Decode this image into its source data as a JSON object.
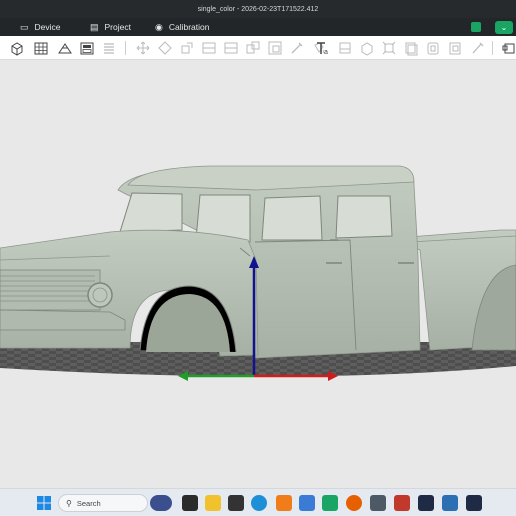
{
  "window": {
    "title": "single_color - 2026-02-23T171522.412"
  },
  "menubar": {
    "tabs": [
      {
        "label": "Device",
        "icon": "monitor-icon"
      },
      {
        "label": "Project",
        "icon": "project-icon"
      },
      {
        "label": "Calibration",
        "icon": "calibration-icon"
      }
    ],
    "right_button_icon": "chevron-down-icon"
  },
  "toolbar": {
    "icons": [
      "add-cube-icon",
      "grid-icon",
      "auto-orient-icon",
      "arrange-icon",
      "list-icon",
      "move-icon",
      "rotate-icon",
      "scale-icon",
      "cut-icon",
      "boolean-icon",
      "support-icon",
      "paint-icon",
      "seam-icon",
      "text-icon",
      "slice-plane-icon",
      "measure-icon",
      "assembly-icon",
      "split-icon",
      "variable-layer-icon",
      "emboss-icon"
    ]
  },
  "viewport": {
    "scene": "pickup-truck-model",
    "colors": {
      "model": "#b8c2b6",
      "bed": "#5b5b5b",
      "x_axis": "#d01c1c",
      "y_axis": "#1f9e2a",
      "z_axis": "#12128f"
    }
  },
  "taskbar": {
    "search_placeholder": "Search",
    "apps": [
      "windows-start-icon",
      "search-icon",
      "widgets-icon",
      "task-view-icon",
      "file-explorer-icon",
      "app-icon",
      "edge-icon",
      "app-icon",
      "store-icon",
      "app-icon",
      "firefox-icon",
      "calculator-icon",
      "app-icon",
      "app-icon",
      "app-icon",
      "app-icon"
    ]
  }
}
